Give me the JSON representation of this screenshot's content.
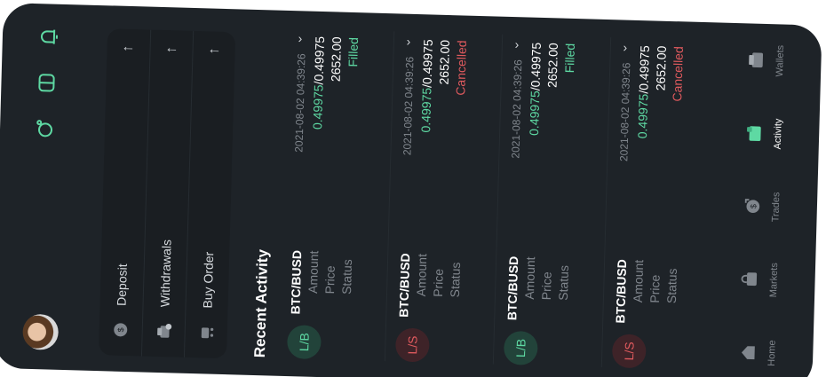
{
  "actions": {
    "deposit_label": "Deposit",
    "withdrawals_label": "Withdrawals",
    "buy_order_label": "Buy Order",
    "arrow": "↑"
  },
  "recent": {
    "title": "Recent Activity",
    "labels": {
      "amount": "Amount",
      "price": "Price",
      "status": "Status"
    },
    "items": [
      {
        "badge": "L/B",
        "side": "buy",
        "pair": "BTC/BUSD",
        "datetime": "2021-08-02 04:39:26",
        "filled": "0.49975",
        "total": "/0.49975",
        "price": "2652.00",
        "status": "Filled",
        "status_kind": "ok"
      },
      {
        "badge": "L/S",
        "side": "sell",
        "pair": "BTC/BUSD",
        "datetime": "2021-08-02 04:39:26",
        "filled": "0.49975",
        "total": "/0.49975",
        "price": "2652.00",
        "status": "Cancelled",
        "status_kind": "bad"
      },
      {
        "badge": "L/B",
        "side": "buy",
        "pair": "BTC/BUSD",
        "datetime": "2021-08-02 04:39:26",
        "filled": "0.49975",
        "total": "/0.49975",
        "price": "2652.00",
        "status": "Filled",
        "status_kind": "ok"
      },
      {
        "badge": "L/S",
        "side": "sell",
        "pair": "BTC/BUSD",
        "datetime": "2021-08-02 04:39:26",
        "filled": "0.49975",
        "total": "/0.49975",
        "price": "2652.00",
        "status": "Cancelled",
        "status_kind": "bad"
      }
    ]
  },
  "nav": {
    "home": "Home",
    "markets": "Markets",
    "trades": "Trades",
    "activity": "Activity",
    "wallets": "Wallets",
    "active": "activity"
  },
  "colors": {
    "accent": "#5ed9a3",
    "danger": "#e05a5e",
    "background": "#1e2328",
    "panel": "#1a1e22",
    "muted": "#80868d"
  },
  "icons": [
    "avatar",
    "notification-icon",
    "card-icon",
    "search-icon",
    "coin-icon",
    "withdraw-icon",
    "cart-icon",
    "home-icon",
    "markets-icon",
    "trades-icon",
    "activity-icon",
    "wallets-icon",
    "chevron-up-icon"
  ]
}
